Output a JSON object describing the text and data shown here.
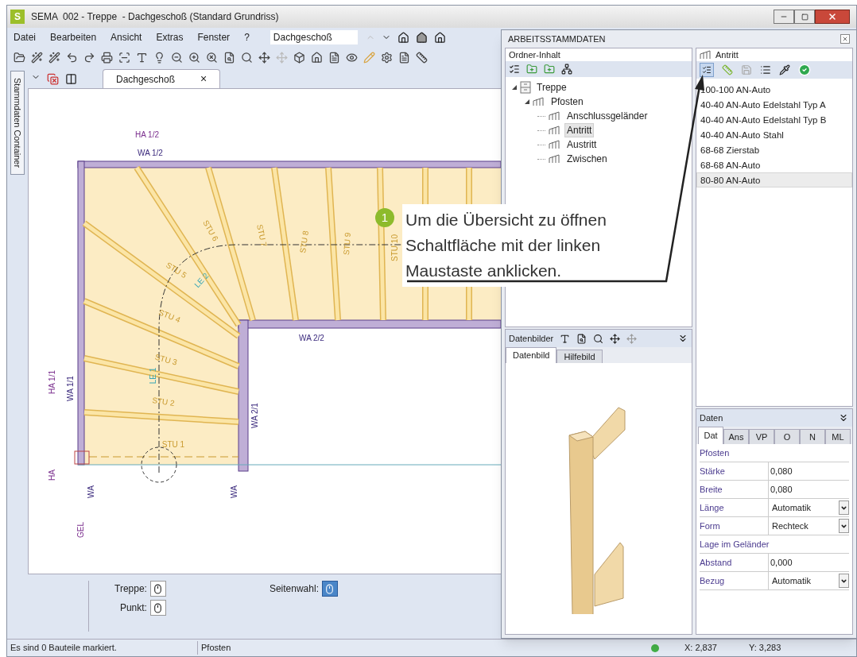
{
  "window": {
    "logo": "S",
    "title": "SEMA  002 - Treppe  - Dachgeschoß (Standard Grundriss)"
  },
  "menu": [
    "Datei",
    "Bearbeiten",
    "Ansicht",
    "Extras",
    "Fenster",
    "?"
  ],
  "floor_select": {
    "value": "Dachgeschoß"
  },
  "sidebar": {
    "label": "Stammdaten Container"
  },
  "document_tabs": [
    {
      "label": "Dachgeschoß",
      "close": "×",
      "selected": true
    }
  ],
  "drawing_labels": [
    {
      "text": "HA 1/2",
      "kind": "axis"
    },
    {
      "text": "WA 1/2",
      "kind": "wall"
    },
    {
      "text": "STU 1",
      "kind": "step"
    },
    {
      "text": "STU 2",
      "kind": "step"
    },
    {
      "text": "STU 3",
      "kind": "step"
    },
    {
      "text": "STU 4",
      "kind": "step"
    },
    {
      "text": "STU 5",
      "kind": "step"
    },
    {
      "text": "STU 6",
      "kind": "step"
    },
    {
      "text": "STU 7",
      "kind": "step"
    },
    {
      "text": "STU 8",
      "kind": "step"
    },
    {
      "text": "STU 9",
      "kind": "step"
    },
    {
      "text": "STU 10",
      "kind": "step"
    },
    {
      "text": "LE 2",
      "kind": "line"
    },
    {
      "text": "LE 1",
      "kind": "line"
    },
    {
      "text": "WA 2/2",
      "kind": "wall"
    },
    {
      "text": "WA 2/1",
      "kind": "wall"
    },
    {
      "text": "HA 1/1",
      "kind": "axis"
    },
    {
      "text": "WA 1/1",
      "kind": "wall"
    },
    {
      "text": "HA",
      "kind": "axis"
    },
    {
      "text": "WA",
      "kind": "wall"
    },
    {
      "text": "WA",
      "kind": "wall"
    },
    {
      "text": "GEL",
      "kind": "axis"
    }
  ],
  "bottom_options": [
    {
      "label": "Treppe:",
      "selected": false
    },
    {
      "label": "Punkt:",
      "selected": false
    },
    {
      "label": "Seitenwahl:",
      "selected": true
    }
  ],
  "status_bar": {
    "message": "Es sind 0 Bauteile markiert.",
    "object": "Pfosten",
    "x": "X: 2,837",
    "y": "Y: 3,283"
  },
  "panel": {
    "title": "ARBEITSSTAMMDATEN",
    "folder_title": "Ordner-Inhalt",
    "tree": [
      {
        "label": "Treppe",
        "kind": "cabinet",
        "expanded": true,
        "selected": false,
        "children": [
          {
            "label": "Pfosten",
            "kind": "rail",
            "expanded": true,
            "selected": false,
            "children": [
              {
                "label": "Anschlussgeländer",
                "kind": "rail",
                "selected": false
              },
              {
                "label": "Antritt",
                "kind": "rail",
                "selected": true
              },
              {
                "label": "Austritt",
                "kind": "rail",
                "selected": false
              },
              {
                "label": "Zwischen",
                "kind": "rail",
                "selected": false
              }
            ]
          }
        ]
      }
    ],
    "list_title": "Antritt",
    "list": [
      {
        "label": "100-100 AN-Auto",
        "selected": false
      },
      {
        "label": "40-40 AN-Auto Edelstahl Typ A",
        "selected": false
      },
      {
        "label": "40-40 AN-Auto Edelstahl Typ B",
        "selected": false
      },
      {
        "label": "40-40 AN-Auto Stahl",
        "selected": false
      },
      {
        "label": "68-68  Zierstab",
        "selected": false
      },
      {
        "label": "68-68 AN-Auto",
        "selected": false
      },
      {
        "label": "80-80 AN-Auto",
        "selected": true
      }
    ],
    "images": {
      "title": "Datenbilder",
      "tabs": [
        {
          "label": "Datenbild",
          "selected": true
        },
        {
          "label": "Hilfebild",
          "selected": false
        }
      ]
    },
    "data": {
      "title": "Daten",
      "tabs": [
        {
          "label": "Dat",
          "selected": true
        },
        {
          "label": "Ans",
          "selected": false
        },
        {
          "label": "VP",
          "selected": false
        },
        {
          "label": "O",
          "selected": false
        },
        {
          "label": "N",
          "selected": false
        },
        {
          "label": "ML",
          "selected": false
        }
      ],
      "rows": [
        {
          "kind": "section",
          "label": "Pfosten"
        },
        {
          "kind": "value",
          "label": "Stärke",
          "value": "0,080"
        },
        {
          "kind": "value",
          "label": "Breite",
          "value": "0,080"
        },
        {
          "kind": "dropdown",
          "label": "Länge",
          "value": "Automatik"
        },
        {
          "kind": "dropdown",
          "label": "Form",
          "value": "Rechteck"
        },
        {
          "kind": "section",
          "label": "Lage im Geländer"
        },
        {
          "kind": "value",
          "label": "Abstand",
          "value": "0,000"
        },
        {
          "kind": "dropdown",
          "label": "Bezug",
          "value": "Automatik"
        }
      ]
    }
  },
  "callout": {
    "number": "1",
    "text": "Um die Übersicht zu öffnen Schaltfläche mit der linken Maustaste anklicken."
  }
}
